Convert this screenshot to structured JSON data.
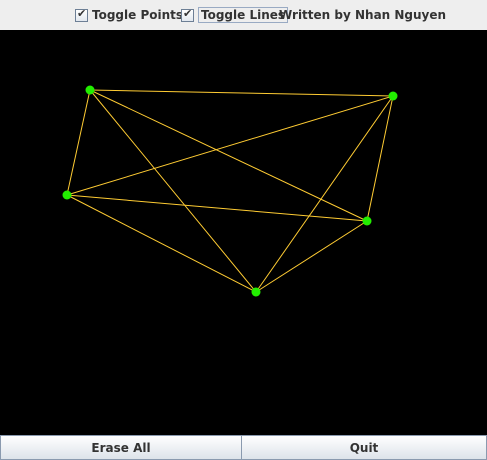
{
  "toolbar": {
    "toggle_points": {
      "label": "Toggle Points",
      "checked": true
    },
    "toggle_lines": {
      "label": "Toggle Lines",
      "checked": true
    },
    "credit": "Written by Nhan Nguyen"
  },
  "buttons": {
    "erase_all": "Erase All",
    "quit": "Quit"
  },
  "colors": {
    "canvas_background": "#000000",
    "point": "#22ee00",
    "line": "#ffcc33"
  }
}
